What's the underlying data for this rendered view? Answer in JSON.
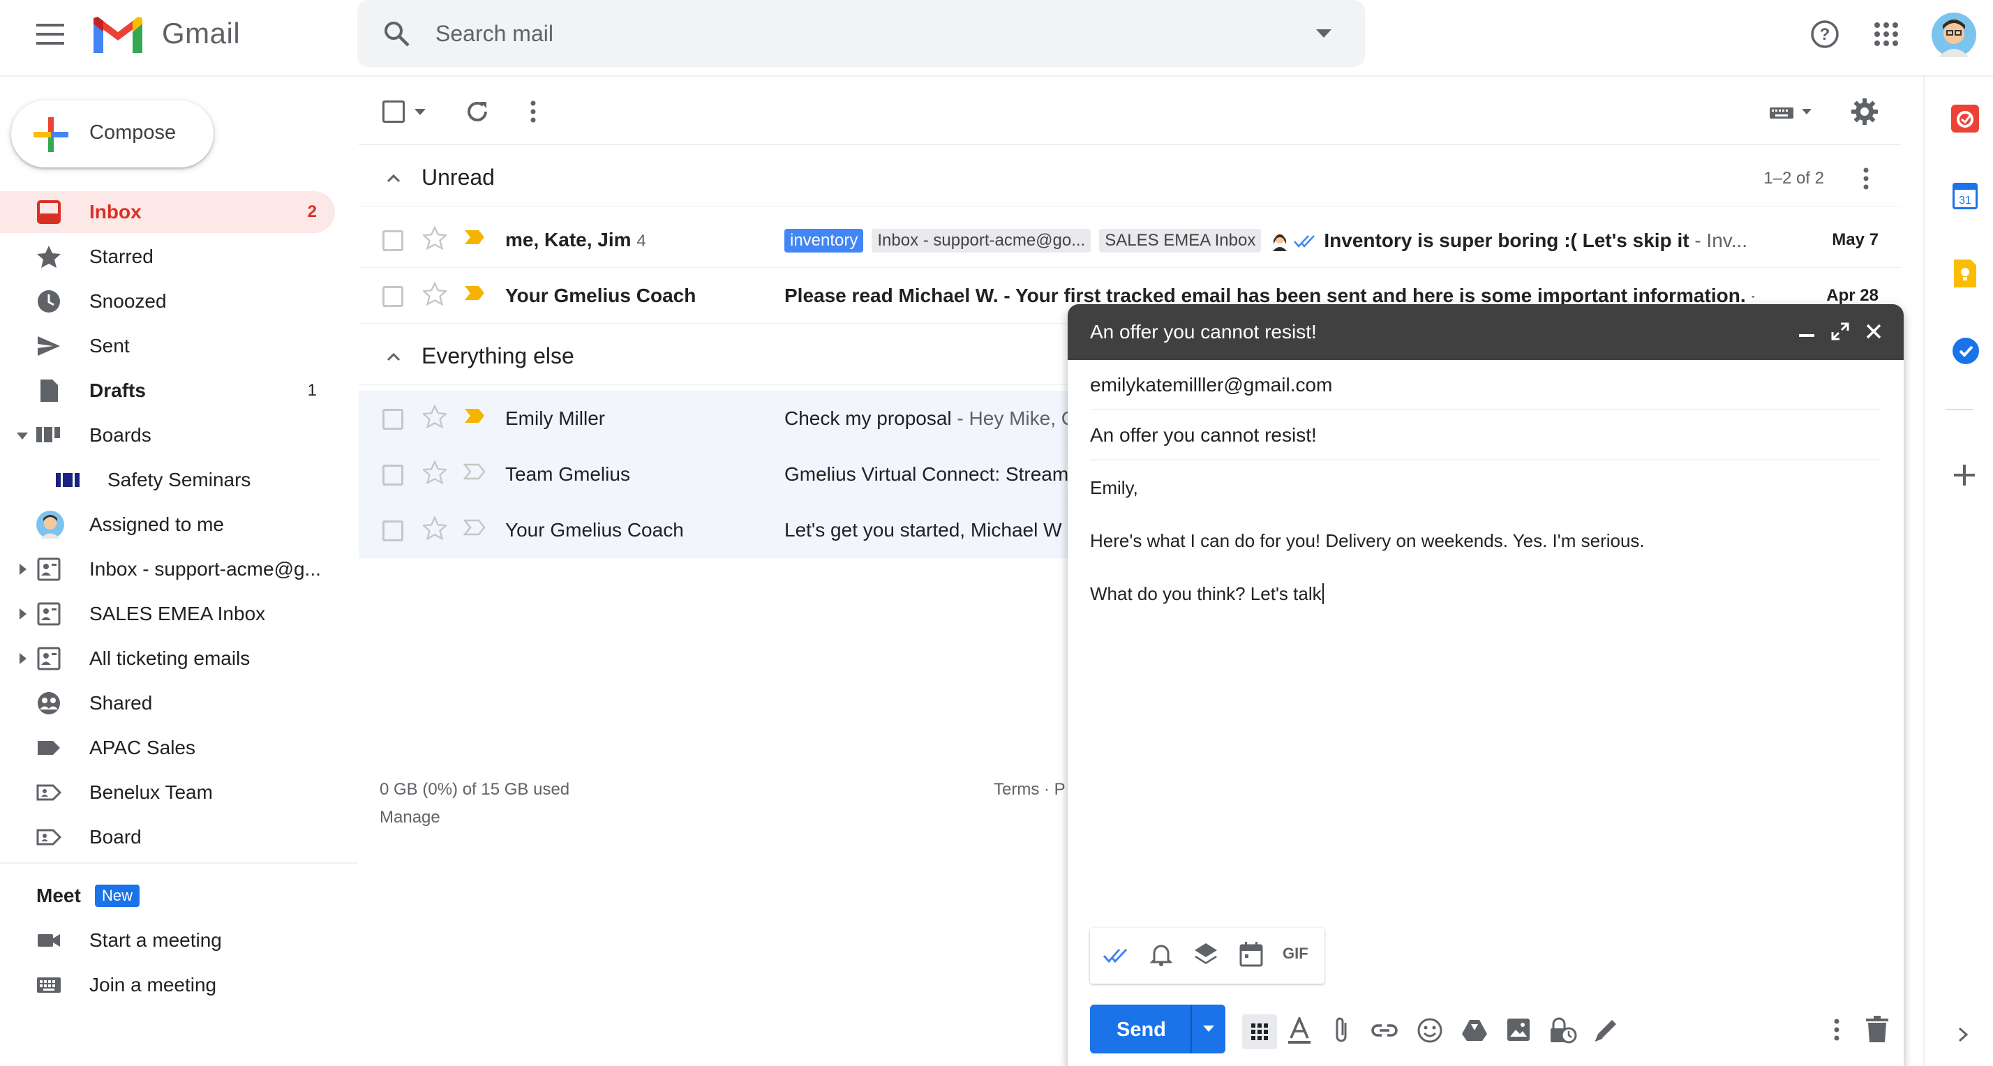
{
  "header": {
    "app_name": "Gmail",
    "search_placeholder": "Search mail"
  },
  "compose_button": {
    "label": "Compose"
  },
  "sidebar": {
    "items": [
      {
        "label": "Inbox",
        "count": "2",
        "icon": "inbox-icon"
      },
      {
        "label": "Starred",
        "count": "",
        "icon": "star-icon"
      },
      {
        "label": "Snoozed",
        "count": "",
        "icon": "clock-icon"
      },
      {
        "label": "Sent",
        "count": "",
        "icon": "send-icon"
      },
      {
        "label": "Drafts",
        "count": "1",
        "icon": "draft-icon"
      },
      {
        "label": "Boards",
        "count": "",
        "icon": "boards-icon"
      },
      {
        "label": "Safety Seminars",
        "count": "",
        "icon": "board-icon"
      },
      {
        "label": "Assigned to me",
        "count": "",
        "icon": "avatar-icon"
      },
      {
        "label": "Inbox - support-acme@g...",
        "count": "",
        "icon": "shared-inbox-icon"
      },
      {
        "label": "SALES EMEA Inbox",
        "count": "",
        "icon": "shared-inbox-icon"
      },
      {
        "label": "All ticketing emails",
        "count": "",
        "icon": "shared-inbox-icon"
      },
      {
        "label": "Shared",
        "count": "",
        "icon": "shared-icon"
      },
      {
        "label": "APAC Sales",
        "count": "",
        "icon": "label-icon"
      },
      {
        "label": "Benelux Team",
        "count": "",
        "icon": "label-icon"
      },
      {
        "label": "Board",
        "count": "",
        "icon": "label-icon"
      }
    ],
    "meet": {
      "title": "Meet",
      "badge": "New",
      "start": "Start a meeting",
      "join": "Join a meeting"
    }
  },
  "sections": {
    "unread": {
      "title": "Unread",
      "range": "1–2 of 2"
    },
    "everything_else": {
      "title": "Everything else"
    }
  },
  "emails": {
    "unread": [
      {
        "sender": "me, Kate, Jim",
        "thread_count": "4",
        "chips": [
          "inventory",
          "Inbox - support-acme@go...",
          "SALES EMEA Inbox"
        ],
        "subject": "Inventory is super boring :( Let's skip it",
        "snippet": " - Inv...",
        "date": "May 7"
      },
      {
        "sender": "Your Gmelius Coach",
        "subject": "Please read Michael W. - Your first tracked email has been sent and here is some important information.",
        "snippet": " - I",
        "date": "Apr 28"
      }
    ],
    "other": [
      {
        "sender": "Emily Miller",
        "subject": "Check my proposal",
        "snippet": " - Hey Mike, C"
      },
      {
        "sender": "Team Gmelius",
        "subject": "Gmelius Virtual Connect: Stream",
        "snippet": ""
      },
      {
        "sender": "Your Gmelius Coach",
        "subject": "Let's get you started, Michael W",
        "snippet": ""
      }
    ]
  },
  "footer": {
    "storage": "0 GB (0%) of 15 GB used",
    "manage": "Manage",
    "terms": "Terms · P"
  },
  "compose_window": {
    "title": "An offer you cannot resist!",
    "to": "emilykatemilller@gmail.com",
    "subject": "An offer you cannot resist!",
    "body": [
      "Emily,",
      "Here's what I can do for you! Delivery on weekends. Yes. I'm serious.",
      "What do you think? Let's talk"
    ],
    "send_label": "Send",
    "gif_label": "GIF"
  },
  "colors": {
    "accent": "#1a73e8",
    "inbox_active": "#d93025",
    "chip_inventory": "#4285f4",
    "importance": "#f4b400"
  }
}
